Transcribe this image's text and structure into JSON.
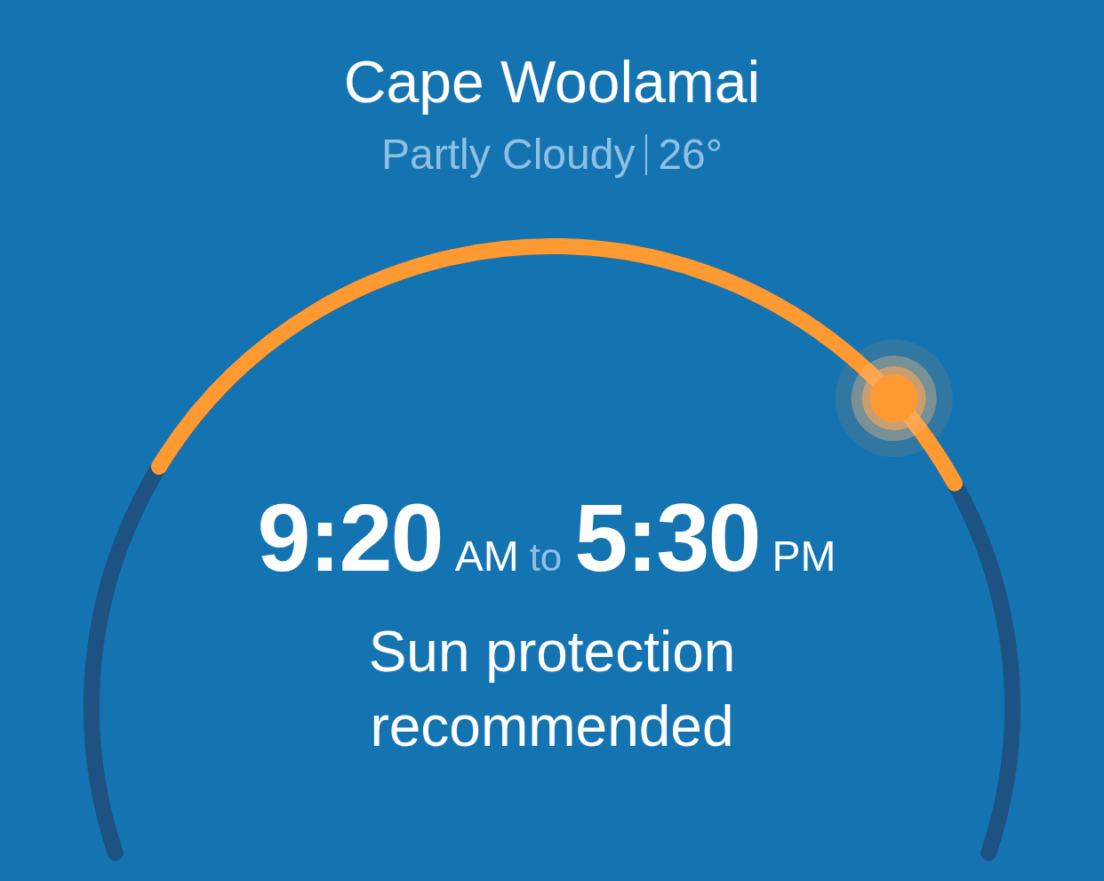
{
  "location": {
    "name": "Cape Woolamai"
  },
  "conditions": {
    "summary": "Partly Cloudy",
    "temperature": "26°"
  },
  "protection": {
    "start_time": "9:20",
    "start_period": "AM",
    "joiner": "to",
    "end_time": "5:30",
    "end_period": "PM",
    "message": "Sun protection recommended"
  }
}
